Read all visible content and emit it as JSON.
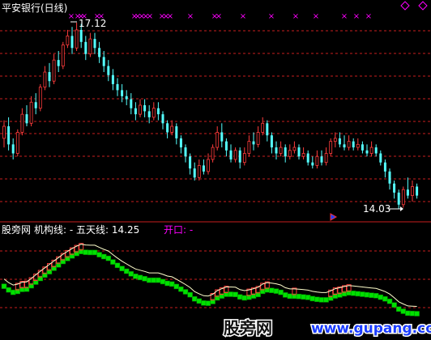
{
  "header": {
    "title": "平安银行(日线)"
  },
  "annotations": {
    "high_label": "17.12",
    "low_label": "14.03"
  },
  "signals": {
    "glyph": "×"
  },
  "indicator": {
    "source": "股旁网",
    "institution_line": "机构线: -",
    "five_day_line": "五天线: 14.25",
    "opening": "开口: -"
  },
  "watermark": {
    "name": "股旁网",
    "url": "www.gupang.com"
  },
  "colors": {
    "background": "#000000",
    "rise": "#ff3c3c",
    "fall": "#54ffff",
    "grid": "#c81e1e",
    "signal": "#ff00ff",
    "band": "#00e000"
  },
  "chart_data": {
    "type": "candlestick",
    "title": "平安银行(日线)",
    "fields": [
      "open",
      "close",
      "high",
      "low"
    ],
    "y_range": [
      14.03,
      17.12
    ],
    "grid": true,
    "candles": [
      [
        15.2,
        15.4,
        15.5,
        15.05
      ],
      [
        15.4,
        15.1,
        15.55,
        15.0
      ],
      [
        15.1,
        14.95,
        15.2,
        14.85
      ],
      [
        14.95,
        15.3,
        15.35,
        14.9
      ],
      [
        15.3,
        15.6,
        15.7,
        15.25
      ],
      [
        15.6,
        15.45,
        15.75,
        15.4
      ],
      [
        15.45,
        15.8,
        15.9,
        15.4
      ],
      [
        15.8,
        15.7,
        15.95,
        15.6
      ],
      [
        15.7,
        16.05,
        16.1,
        15.65
      ],
      [
        16.05,
        16.3,
        16.4,
        16.0
      ],
      [
        16.3,
        16.15,
        16.45,
        16.05
      ],
      [
        16.15,
        16.5,
        16.6,
        16.1
      ],
      [
        16.5,
        16.4,
        16.65,
        16.3
      ],
      [
        16.4,
        16.75,
        16.8,
        16.35
      ],
      [
        16.75,
        16.9,
        17.0,
        16.7
      ],
      [
        16.9,
        16.7,
        17.05,
        16.6
      ],
      [
        16.7,
        17.0,
        17.12,
        16.65
      ],
      [
        17.0,
        16.8,
        17.1,
        16.7
      ],
      [
        16.8,
        16.6,
        16.9,
        16.5
      ],
      [
        16.6,
        16.85,
        16.95,
        16.55
      ],
      [
        16.85,
        16.7,
        16.95,
        16.6
      ],
      [
        16.7,
        16.55,
        16.8,
        16.45
      ],
      [
        16.55,
        16.4,
        16.65,
        16.3
      ],
      [
        16.4,
        16.25,
        16.5,
        16.15
      ],
      [
        16.25,
        16.1,
        16.35,
        16.0
      ],
      [
        16.1,
        16.0,
        16.2,
        15.9
      ],
      [
        16.0,
        15.9,
        16.1,
        15.8
      ],
      [
        15.9,
        15.85,
        16.0,
        15.75
      ],
      [
        15.85,
        15.7,
        15.95,
        15.6
      ],
      [
        15.7,
        15.6,
        15.8,
        15.5
      ],
      [
        15.6,
        15.75,
        15.85,
        15.55
      ],
      [
        15.75,
        15.65,
        15.85,
        15.55
      ],
      [
        15.65,
        15.55,
        15.75,
        15.45
      ],
      [
        15.55,
        15.7,
        15.8,
        15.5
      ],
      [
        15.7,
        15.6,
        15.8,
        15.5
      ],
      [
        15.6,
        15.45,
        15.65,
        15.35
      ],
      [
        15.45,
        15.3,
        15.5,
        15.2
      ],
      [
        15.3,
        15.4,
        15.5,
        15.25
      ],
      [
        15.4,
        15.2,
        15.45,
        15.1
      ],
      [
        15.2,
        15.05,
        15.25,
        14.95
      ],
      [
        15.05,
        14.9,
        15.1,
        14.8
      ],
      [
        14.9,
        14.7,
        14.95,
        14.6
      ],
      [
        14.7,
        14.55,
        14.8,
        14.5
      ],
      [
        14.55,
        14.75,
        14.85,
        14.5
      ],
      [
        14.75,
        14.65,
        14.85,
        14.6
      ],
      [
        14.65,
        14.85,
        14.95,
        14.6
      ],
      [
        14.85,
        15.05,
        15.1,
        14.8
      ],
      [
        15.05,
        15.3,
        15.4,
        15.0
      ],
      [
        15.3,
        15.15,
        15.45,
        15.05
      ],
      [
        15.15,
        15.0,
        15.2,
        14.9
      ],
      [
        15.0,
        14.85,
        15.1,
        14.8
      ],
      [
        14.85,
        15.0,
        15.05,
        14.8
      ],
      [
        15.0,
        14.8,
        15.05,
        14.7
      ],
      [
        14.8,
        14.95,
        15.05,
        14.75
      ],
      [
        14.95,
        15.15,
        15.25,
        14.9
      ],
      [
        15.15,
        15.1,
        15.3,
        15.0
      ],
      [
        15.1,
        15.3,
        15.4,
        15.05
      ],
      [
        15.3,
        15.45,
        15.55,
        15.25
      ],
      [
        15.45,
        15.25,
        15.5,
        15.15
      ],
      [
        15.25,
        15.05,
        15.3,
        14.95
      ],
      [
        15.05,
        14.95,
        15.15,
        14.85
      ],
      [
        14.95,
        15.05,
        15.15,
        14.9
      ],
      [
        15.05,
        14.9,
        15.1,
        14.8
      ],
      [
        14.9,
        15.0,
        15.1,
        14.85
      ],
      [
        15.0,
        15.05,
        15.15,
        14.95
      ],
      [
        15.05,
        14.9,
        15.1,
        14.85
      ],
      [
        14.9,
        14.95,
        15.05,
        14.85
      ],
      [
        14.95,
        14.8,
        15.0,
        14.75
      ],
      [
        14.8,
        14.75,
        14.9,
        14.7
      ],
      [
        14.75,
        14.9,
        15.0,
        14.7
      ],
      [
        14.9,
        14.8,
        15.0,
        14.75
      ],
      [
        14.8,
        14.95,
        15.05,
        14.75
      ],
      [
        14.95,
        15.15,
        15.2,
        14.9
      ],
      [
        15.15,
        15.2,
        15.3,
        15.05
      ],
      [
        15.2,
        15.1,
        15.3,
        15.05
      ],
      [
        15.1,
        15.05,
        15.25,
        15.0
      ],
      [
        15.05,
        15.15,
        15.25,
        15.0
      ],
      [
        15.15,
        15.05,
        15.2,
        15.0
      ],
      [
        15.05,
        15.1,
        15.2,
        15.0
      ],
      [
        15.1,
        15.0,
        15.15,
        14.95
      ],
      [
        15.0,
        14.95,
        15.1,
        14.9
      ],
      [
        14.95,
        15.05,
        15.15,
        14.9
      ],
      [
        15.05,
        14.95,
        15.1,
        14.9
      ],
      [
        14.95,
        14.8,
        15.0,
        14.75
      ],
      [
        14.8,
        14.65,
        14.85,
        14.55
      ],
      [
        14.65,
        14.45,
        14.7,
        14.35
      ],
      [
        14.45,
        14.3,
        14.5,
        14.2
      ],
      [
        14.3,
        14.1,
        14.35,
        14.03
      ],
      [
        14.1,
        14.35,
        14.4,
        14.05
      ],
      [
        14.35,
        14.25,
        14.55,
        14.2
      ],
      [
        14.25,
        14.4,
        14.5,
        14.15
      ],
      [
        14.4,
        14.25,
        14.45,
        14.2
      ]
    ]
  }
}
